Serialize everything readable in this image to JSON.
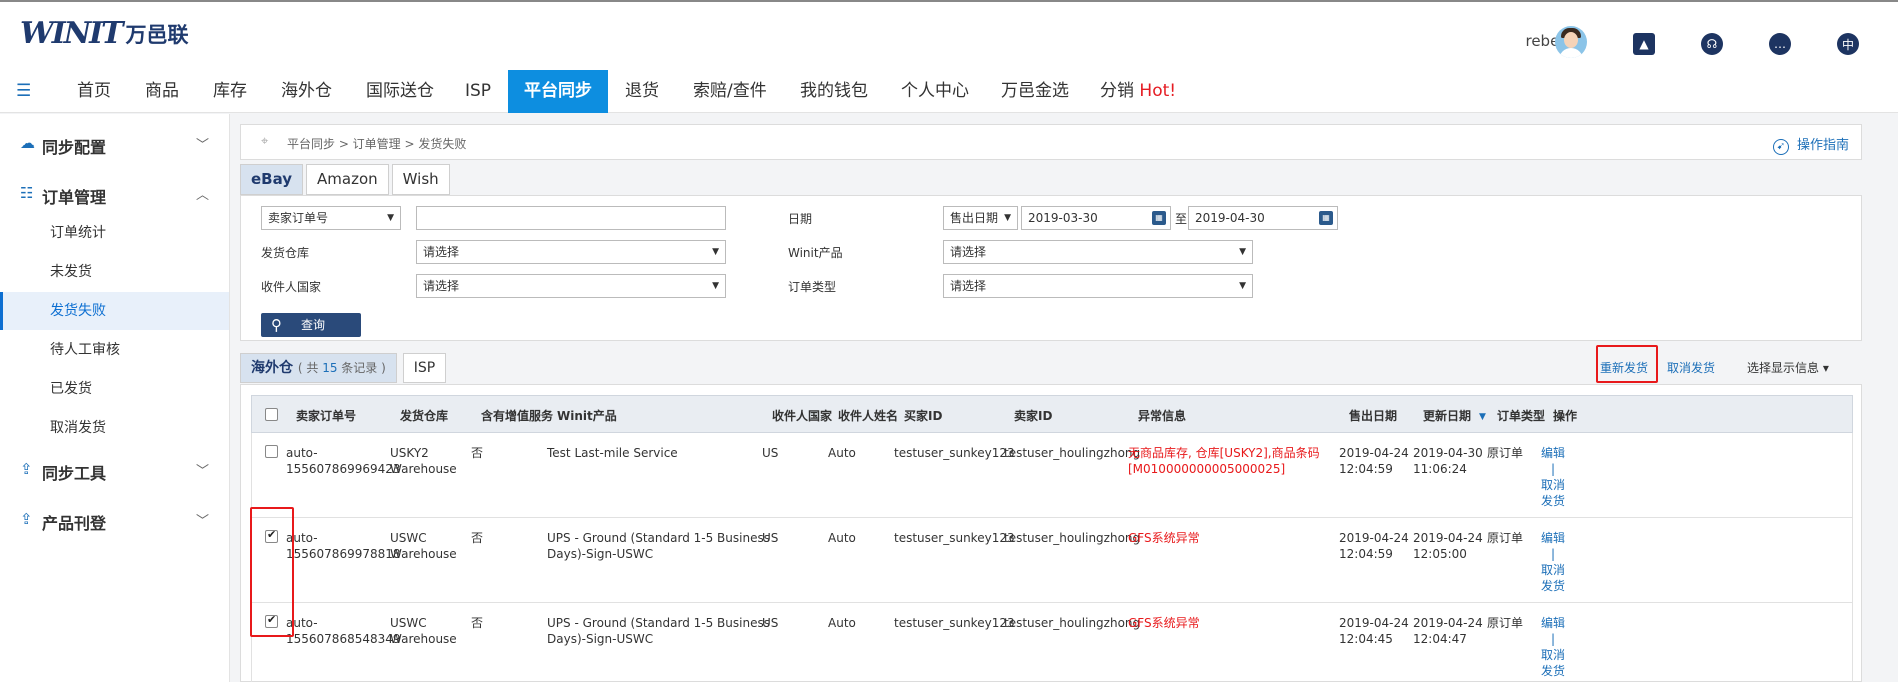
{
  "header": {
    "logo_mark": "WINIT",
    "logo_cn": "万邑联",
    "username": "rebecca"
  },
  "nav": {
    "items": [
      "首页",
      "商品",
      "库存",
      "海外仓",
      "国际送仓",
      "ISP",
      "平台同步",
      "退货",
      "索赔/查件",
      "我的钱包",
      "个人中心",
      "万邑金选",
      "分销"
    ],
    "hot": "Hot!",
    "active": "平台同步"
  },
  "sidebar": {
    "groups": [
      {
        "label": "同步配置",
        "chevron": "﹀"
      },
      {
        "label": "订单管理",
        "chevron": "︿"
      },
      {
        "label": "同步工具",
        "chevron": "﹀"
      },
      {
        "label": "产品刊登",
        "chevron": "﹀"
      }
    ],
    "items": [
      "订单统计",
      "未发货",
      "发货失败",
      "待人工审核",
      "已发货",
      "取消发货"
    ],
    "active_item": "发货失败"
  },
  "breadcrumb": "平台同步 > 订单管理 > 发货失败",
  "guide_label": "操作指南",
  "platform_tabs": [
    "eBay",
    "Amazon",
    "Wish"
  ],
  "filters": {
    "order_type_select": "卖家订单号",
    "order_no_value": "",
    "date_label": "日期",
    "date_type": "售出日期",
    "date_from": "2019-03-30",
    "date_to_label": "至",
    "date_to": "2019-04-30",
    "warehouse_label": "发货仓库",
    "warehouse_value": "请选择",
    "winit_product_label": "Winit产品",
    "winit_product_value": "请选择",
    "country_label": "收件人国家",
    "country_value": "请选择",
    "ordertype_label": "订单类型",
    "ordertype_value": "请选择",
    "query_button": "查询"
  },
  "list_tabs": {
    "overseas": "海外仓",
    "count_prefix": "( 共 ",
    "count": "15",
    "count_suffix": " 条记录 )",
    "isp": "ISP"
  },
  "actions": {
    "resend": "重新发货",
    "cancel": "取消发货",
    "display": "选择显示信息 ▾"
  },
  "table": {
    "headers": [
      "卖家订单号",
      "发货仓库",
      "含有增值服务",
      "Winit产品",
      "收件人国家",
      "收件人姓名",
      "买家ID",
      "卖家ID",
      "异常信息",
      "售出日期",
      "更新日期",
      "订单类型",
      "操作"
    ],
    "rows": [
      {
        "checked": false,
        "order_no": "auto-\n155607869969423",
        "warehouse": "USKY2\nWarehouse",
        "vas": "否",
        "product": "Test Last-mile Service",
        "country": "US",
        "name": "Auto",
        "buyer": "testuser_sunkey123",
        "seller": "testuser_houlingzhong",
        "error": "无商品库存, 仓库[USKY2],商品条码\n[M010000000005000025]",
        "sold": "2019-04-24\n12:04:59",
        "updated": "2019-04-30\n11:06:24",
        "type": "原订单",
        "ops": "编辑\n|\n取消\n发货"
      },
      {
        "checked": true,
        "order_no": "auto-\n155607869978818",
        "warehouse": "USWC\nWarehouse",
        "vas": "否",
        "product": "UPS - Ground (Standard 1-5 Business\nDays)-Sign-USWC",
        "country": "US",
        "name": "Auto",
        "buyer": "testuser_sunkey123",
        "seller": "testuser_houlingzhong",
        "error": "GFS系统异常",
        "sold": "2019-04-24\n12:04:59",
        "updated": "2019-04-24\n12:05:00",
        "type": "原订单",
        "ops": "编辑\n|\n取消\n发货"
      },
      {
        "checked": true,
        "order_no": "auto-\n155607868548349",
        "warehouse": "USWC\nWarehouse",
        "vas": "否",
        "product": "UPS - Ground (Standard 1-5 Business\nDays)-Sign-USWC",
        "country": "US",
        "name": "Auto",
        "buyer": "testuser_sunkey123",
        "seller": "testuser_houlingzhong",
        "error": "GFS系统异常",
        "sold": "2019-04-24\n12:04:45",
        "updated": "2019-04-24\n12:04:47",
        "type": "原订单",
        "ops": "编辑\n|\n取消\n发货"
      }
    ]
  },
  "colors": {
    "primary": "#0d8ee0",
    "navy": "#1f3a6e",
    "link": "#1c6fb8",
    "error": "#e8191b",
    "highlight_box": "#e8191b"
  }
}
